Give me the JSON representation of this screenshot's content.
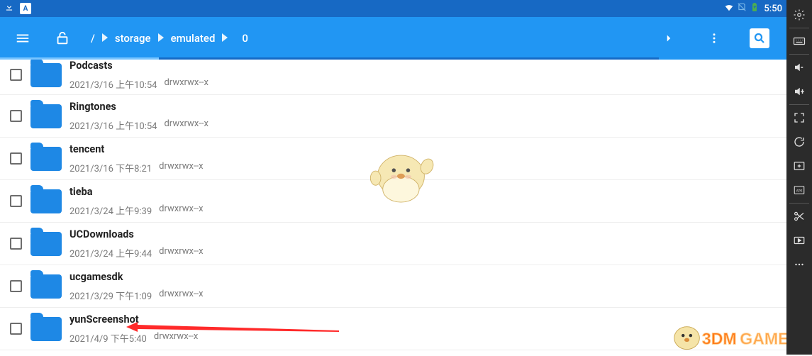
{
  "status_bar": {
    "time": "5:50"
  },
  "app_bar": {
    "breadcrumb": [
      {
        "label": "/"
      },
      {
        "label": "storage"
      },
      {
        "label": "emulated"
      },
      {
        "label": "0"
      }
    ]
  },
  "files": [
    {
      "name": "Podcasts",
      "date": "2021/3/16 上午10:54",
      "perms": "drwxrwx--x"
    },
    {
      "name": "Ringtones",
      "date": "2021/3/16 上午10:54",
      "perms": "drwxrwx--x"
    },
    {
      "name": "tencent",
      "date": "2021/3/16 下午8:21",
      "perms": "drwxrwx--x"
    },
    {
      "name": "tieba",
      "date": "2021/3/24 上午9:39",
      "perms": "drwxrwx--x"
    },
    {
      "name": "UCDownloads",
      "date": "2021/3/24 上午9:44",
      "perms": "drwxrwx--x"
    },
    {
      "name": "ucgamesdk",
      "date": "2021/3/29 下午1:09",
      "perms": "drwxrwx--x"
    },
    {
      "name": "yunScreenshot",
      "date": "2021/4/9 下午5:40",
      "perms": "drwxrwx--x"
    }
  ],
  "watermark": {
    "text1": "3DM",
    "text2": "GAME"
  }
}
